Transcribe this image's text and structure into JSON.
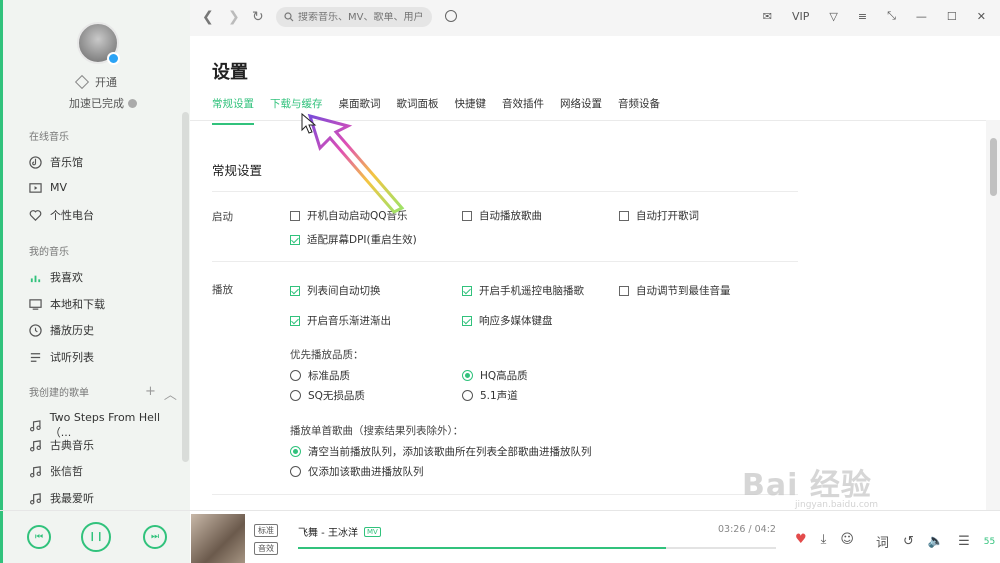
{
  "sidebar": {
    "vip_label": "开通",
    "accel_label": "加速已完成",
    "online_section": "在线音乐",
    "online_items": [
      "音乐馆",
      "MV",
      "个性电台"
    ],
    "my_section": "我的音乐",
    "my_items": [
      "我喜欢",
      "本地和下载",
      "播放历史",
      "试听列表"
    ],
    "created_section": "我创建的歌单",
    "playlists": [
      "Two Steps From Hell（...",
      "古典音乐",
      "张信哲",
      "我最爱听"
    ]
  },
  "topbar": {
    "search_placeholder": "搜索音乐、MV、歌单、用户",
    "vip": "VIP"
  },
  "settings": {
    "title": "设置",
    "tabs": [
      "常规设置",
      "下载与缓存",
      "桌面歌词",
      "歌词面板",
      "快捷键",
      "音效插件",
      "网络设置",
      "音频设备"
    ],
    "active_tab": "常规设置",
    "section_title": "常规设置",
    "startup_label": "启动",
    "startup_options": [
      {
        "label": "开机自动启动QQ音乐",
        "checked": false
      },
      {
        "label": "自动播放歌曲",
        "checked": false
      },
      {
        "label": "自动打开歌词",
        "checked": false
      },
      {
        "label": "适配屏幕DPI(重启生效)",
        "checked": true
      }
    ],
    "play_label": "播放",
    "play_options": [
      {
        "label": "列表间自动切换",
        "checked": true
      },
      {
        "label": "开启手机遥控电脑播歌",
        "checked": true
      },
      {
        "label": "自动调节到最佳音量",
        "checked": false
      },
      {
        "label": "开启音乐渐进渐出",
        "checked": true
      },
      {
        "label": "响应多媒体键盘",
        "checked": true
      }
    ],
    "quality_title": "优先播放品质：",
    "quality_options": [
      {
        "label": "标准品质",
        "selected": false
      },
      {
        "label": "HQ高品质",
        "selected": true
      },
      {
        "label": "SQ无损品质",
        "selected": false
      },
      {
        "label": "5.1声道",
        "selected": false
      }
    ],
    "single_title": "播放单首歌曲（搜索结果列表除外）：",
    "single_options": [
      {
        "label": "清空当前播放队列，添加该歌曲所在列表全部歌曲进播放队列",
        "selected": true
      },
      {
        "label": "仅添加该歌曲进播放队列",
        "selected": false
      }
    ]
  },
  "player": {
    "quality_badge": "标准",
    "effect_badge": "音效",
    "song_title": "飞舞 - 王冰洋",
    "mv_badge": "MV",
    "time": "03:26 / 04:2",
    "progress": 0.77,
    "lyrics_btn": "词",
    "playlist_count": "55"
  },
  "watermark": {
    "main": "Bai 经验",
    "sub": "jingyan.baidu.com"
  },
  "colors": {
    "accent": "#31c27c",
    "sidebar_bg": "#f1f4f1"
  }
}
